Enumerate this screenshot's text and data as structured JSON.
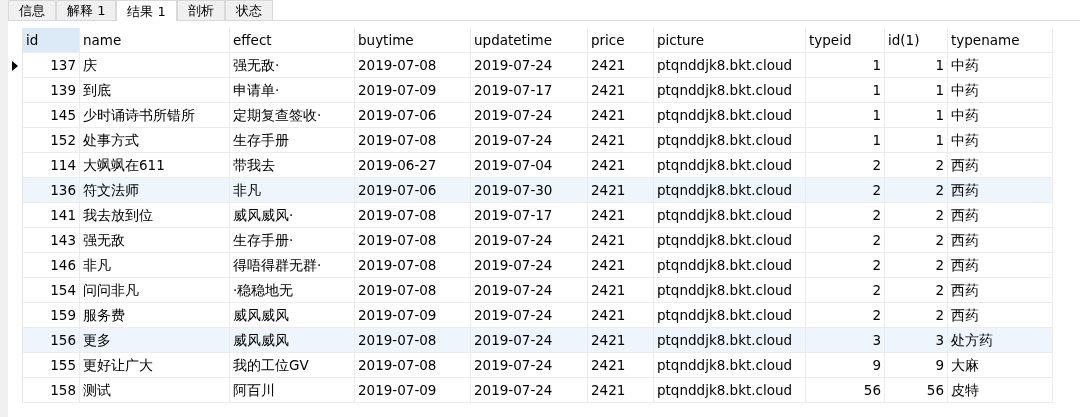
{
  "tabs": [
    {
      "label": "信息",
      "selected": false
    },
    {
      "label": "解释 1",
      "selected": false
    },
    {
      "label": "结果 1",
      "selected": true
    },
    {
      "label": "剖析",
      "selected": false
    },
    {
      "label": "状态",
      "selected": false
    }
  ],
  "table": {
    "columns": [
      {
        "label": "id",
        "kind": "number",
        "selected": true
      },
      {
        "label": "name",
        "kind": "text",
        "selected": false
      },
      {
        "label": "effect",
        "kind": "text",
        "selected": false
      },
      {
        "label": "buytime",
        "kind": "text",
        "selected": false
      },
      {
        "label": "updatetime",
        "kind": "text",
        "selected": false
      },
      {
        "label": "price",
        "kind": "text",
        "selected": false
      },
      {
        "label": "picture",
        "kind": "text",
        "selected": false
      },
      {
        "label": "typeid",
        "kind": "number",
        "selected": false
      },
      {
        "label": "id(1)",
        "kind": "number",
        "selected": false
      },
      {
        "label": "typename",
        "kind": "text",
        "selected": false
      }
    ],
    "rows": [
      {
        "selected": true,
        "highlighted": false,
        "cells": [
          "137",
          "庆",
          "强无敌·",
          "2019-07-08",
          "2019-07-24",
          "2421",
          "ptqnddjk8.bkt.cloud",
          "1",
          "1",
          "中药"
        ]
      },
      {
        "selected": false,
        "highlighted": false,
        "cells": [
          "139",
          "到底",
          "申请单·",
          "2019-07-09",
          "2019-07-17",
          "2421",
          "ptqnddjk8.bkt.cloud",
          "1",
          "1",
          "中药"
        ]
      },
      {
        "selected": false,
        "highlighted": false,
        "cells": [
          "145",
          "少时诵诗书所错所",
          "定期复查签收·",
          "2019-07-06",
          "2019-07-24",
          "2421",
          "ptqnddjk8.bkt.cloud",
          "1",
          "1",
          "中药"
        ]
      },
      {
        "selected": false,
        "highlighted": false,
        "cells": [
          "152",
          "处事方式",
          "生存手册",
          "2019-07-08",
          "2019-07-24",
          "2421",
          "ptqnddjk8.bkt.cloud",
          "1",
          "1",
          "中药"
        ]
      },
      {
        "selected": false,
        "highlighted": false,
        "cells": [
          "114",
          "大飒飒在611",
          "带我去",
          "2019-06-27",
          "2019-07-04",
          "2421",
          "ptqnddjk8.bkt.cloud",
          "2",
          "2",
          "西药"
        ]
      },
      {
        "selected": false,
        "highlighted": true,
        "cells": [
          "136",
          "符文法师",
          "非凡",
          "2019-07-06",
          "2019-07-30",
          "2421",
          "ptqnddjk8.bkt.cloud",
          "2",
          "2",
          "西药"
        ]
      },
      {
        "selected": false,
        "highlighted": false,
        "cells": [
          "141",
          "我去放到位",
          "威风威风·",
          "2019-07-08",
          "2019-07-17",
          "2421",
          "ptqnddjk8.bkt.cloud",
          "2",
          "2",
          "西药"
        ]
      },
      {
        "selected": false,
        "highlighted": false,
        "cells": [
          "143",
          "强无敌",
          "生存手册·",
          "2019-07-08",
          "2019-07-24",
          "2421",
          "ptqnddjk8.bkt.cloud",
          "2",
          "2",
          "西药"
        ]
      },
      {
        "selected": false,
        "highlighted": false,
        "cells": [
          "146",
          "非凡",
          "得唔得群无群·",
          "2019-07-08",
          "2019-07-24",
          "2421",
          "ptqnddjk8.bkt.cloud",
          "2",
          "2",
          "西药"
        ]
      },
      {
        "selected": false,
        "highlighted": false,
        "cells": [
          "154",
          "问问非凡",
          "·稳稳地无",
          "2019-07-08",
          "2019-07-24",
          "2421",
          "ptqnddjk8.bkt.cloud",
          "2",
          "2",
          "西药"
        ]
      },
      {
        "selected": false,
        "highlighted": false,
        "cells": [
          "159",
          "服务费",
          "威风威风",
          "2019-07-09",
          "2019-07-24",
          "2421",
          "ptqnddjk8.bkt.cloud",
          "2",
          "2",
          "西药"
        ]
      },
      {
        "selected": false,
        "highlighted": true,
        "cells": [
          "156",
          "更多",
          "威风威风",
          "2019-07-08",
          "2019-07-24",
          "2421",
          "ptqnddjk8.bkt.cloud",
          "3",
          "3",
          "处方药"
        ]
      },
      {
        "selected": false,
        "highlighted": false,
        "cells": [
          "155",
          "更好让广大",
          "我的工位GV",
          "2019-07-08",
          "2019-07-24",
          "2421",
          "ptqnddjk8.bkt.cloud",
          "9",
          "9",
          "大麻"
        ]
      },
      {
        "selected": false,
        "highlighted": false,
        "cells": [
          "158",
          "测试",
          "阿百川",
          "2019-07-09",
          "2019-07-24",
          "2421",
          "ptqnddjk8.bkt.cloud",
          "56",
          "56",
          "皮特"
        ]
      }
    ]
  }
}
